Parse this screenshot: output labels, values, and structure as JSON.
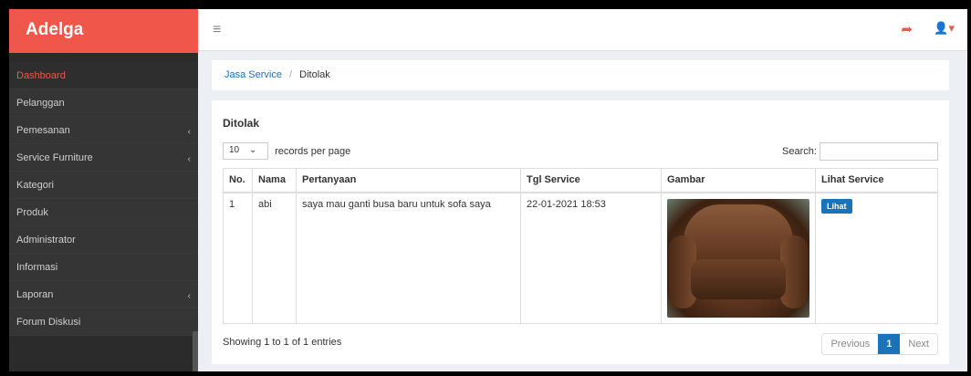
{
  "brand": "Adelga",
  "icons": {
    "menu": "hamburger-icon",
    "share": "share-icon",
    "user": "user-icon"
  },
  "sidebar": {
    "items": [
      {
        "label": "Dashboard",
        "active": true,
        "has_sub": false
      },
      {
        "label": "Pelanggan",
        "active": false,
        "has_sub": false
      },
      {
        "label": "Pemesanan",
        "active": false,
        "has_sub": true
      },
      {
        "label": "Service Furniture",
        "active": false,
        "has_sub": true
      },
      {
        "label": "Kategori",
        "active": false,
        "has_sub": false
      },
      {
        "label": "Produk",
        "active": false,
        "has_sub": false
      },
      {
        "label": "Administrator",
        "active": false,
        "has_sub": false
      },
      {
        "label": "Informasi",
        "active": false,
        "has_sub": false
      },
      {
        "label": "Laporan",
        "active": false,
        "has_sub": true
      },
      {
        "label": "Forum Diskusi",
        "active": false,
        "has_sub": false
      }
    ]
  },
  "breadcrumb": {
    "parent": "Jasa Service",
    "separator": "/",
    "current": "Ditolak"
  },
  "panel": {
    "title": "Ditolak",
    "length_value": "10",
    "length_label": "records per page",
    "search_label": "Search:",
    "columns": [
      "No.",
      "Nama",
      "Pertanyaan",
      "Tgl Service",
      "Gambar",
      "Lihat Service"
    ],
    "rows": [
      {
        "no": "1",
        "nama": "abi",
        "pertanyaan": "saya mau ganti busa baru untuk sofa saya",
        "tgl": "22-01-2021 18:53",
        "action": "Lihat"
      }
    ],
    "info": "Showing 1 to 1 of 1 entries",
    "pager": {
      "prev": "Previous",
      "current": "1",
      "next": "Next"
    }
  },
  "colors": {
    "brand": "#f0574a",
    "primary": "#1a73b8",
    "sidebar": "#2b2b2b"
  }
}
